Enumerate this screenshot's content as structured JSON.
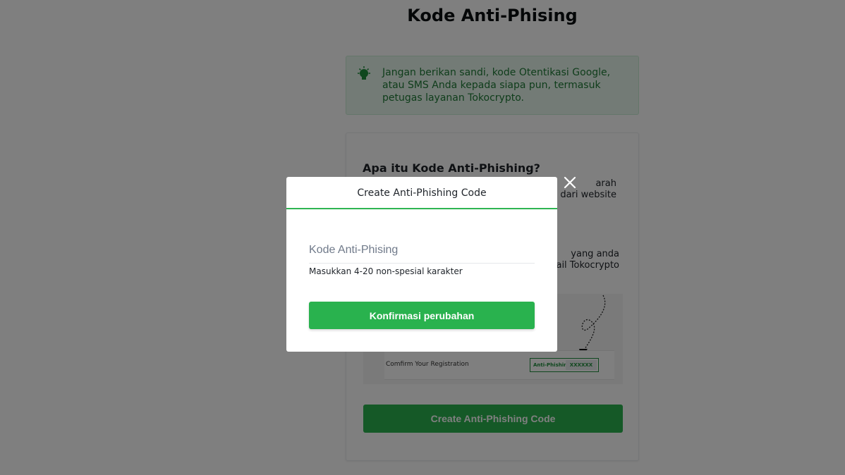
{
  "page": {
    "title": "Kode Anti-Phising"
  },
  "notice": {
    "icon": "lightbulb-icon",
    "text": "Jangan berikan sandi, kode Otentikasi Google, atau SMS Anda kepada siapa pun, termasuk petugas layanan Tokocrypto."
  },
  "info_card": {
    "title": "Apa itu Kode Anti-Phishing?",
    "paragraph1_visible": "arah\nn dari website",
    "paragraph2_visible": "yang anda\nnail Tokocrypto",
    "illustration": {
      "confirm_text": "Comfirm Your Registration",
      "anti_phishing_label": "Anti-Phishing",
      "code_sample": "XXXXXX"
    },
    "create_button": "Create Anti-Phishing Code"
  },
  "modal": {
    "title": "Create Anti-Phishing Code",
    "input": {
      "placeholder": "Kode Anti-Phising",
      "value": ""
    },
    "hint": "Masukkan 4-20 non-spesial karakter",
    "confirm_button": "Konfirmasi perubahan",
    "close_icon": "close-icon"
  },
  "colors": {
    "accent": "#2ab34f",
    "notice_bg": "#e6f7ec",
    "notice_text": "#1f7a36",
    "overlay": "rgba(0,0,0,0.5)"
  }
}
